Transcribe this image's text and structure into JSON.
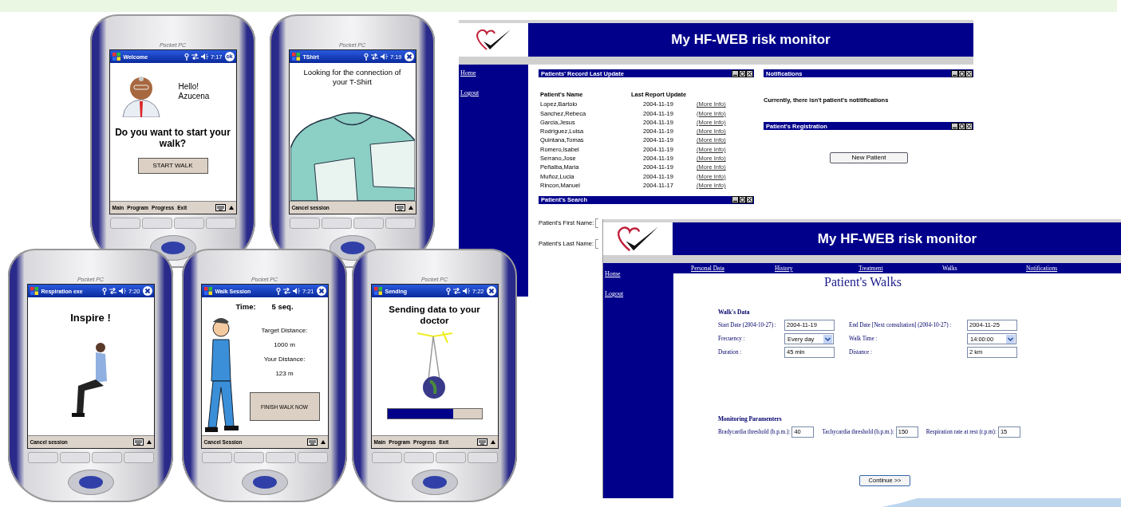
{
  "phones": [
    {
      "kind": "welcome",
      "brand": "Pocket PC",
      "title": "Welcome",
      "time": "7:17",
      "title_button": {
        "kind": "ok",
        "label": "ok"
      },
      "greeting": "Hello!",
      "name": "Azucena",
      "question": "Do you want to start your walk?",
      "button": "START WALK",
      "menu": [
        "Main",
        "Program",
        "Progress",
        "Exit"
      ]
    },
    {
      "kind": "tshirt",
      "brand": "Pocket PC",
      "title": "TShirt",
      "time": "7:19",
      "title_button": {
        "kind": "close"
      },
      "message": "Looking for the connection of your T-Shirt",
      "menu": [
        "Cancel session"
      ]
    },
    {
      "kind": "respiration",
      "brand": "Pocket PC",
      "title": "Respiration exe",
      "time": "7:20",
      "title_button": {
        "kind": "close"
      },
      "instruction": "Inspire !",
      "menu": [
        "Cancel session"
      ]
    },
    {
      "kind": "walk",
      "brand": "Pocket PC",
      "title": "Walk Session",
      "time": "7:21",
      "title_button": {
        "kind": "close"
      },
      "time_label": "Time:",
      "time_value": "5 seq.",
      "target_label": "Target Distance:",
      "target_value": "1000 m",
      "distance_label": "Your Distance:",
      "distance_value": "123 m",
      "button": "FINISH WALK NOW",
      "menu": [
        "Cancel Session"
      ]
    },
    {
      "kind": "sending",
      "brand": "Pocket PC",
      "title": "Sending",
      "time": "7:22",
      "title_button": {
        "kind": "close"
      },
      "message": "Sending data to your doctor",
      "progress": {
        "level": 0.7
      },
      "menu": [
        "Main",
        "Program",
        "Progress",
        "Exit"
      ]
    }
  ],
  "dashboard": {
    "title": "My HF-WEB risk monitor",
    "sidebar": [
      "Home",
      "Logout"
    ],
    "records": {
      "title": "Patients' Record Last Update",
      "columns": [
        "Patient's Name",
        "Last Report Update"
      ],
      "rows": [
        {
          "name": "Lopez,Bartolo",
          "date": "2004-11-19",
          "link": "(More Info)"
        },
        {
          "name": "Sanchez,Rebeca",
          "date": "2004-11-19",
          "link": "(More Info)"
        },
        {
          "name": "Garcia,Jesus",
          "date": "2004-11-19",
          "link": "(More Info)"
        },
        {
          "name": "Rodriguez,Luisa",
          "date": "2004-11-19",
          "link": "(More Info)"
        },
        {
          "name": "Quintana,Tomas",
          "date": "2004-11-19",
          "link": "(More Info)"
        },
        {
          "name": "Romero,Isabel",
          "date": "2004-11-19",
          "link": "(More Info)"
        },
        {
          "name": "Serrano,Jose",
          "date": "2004-11-19",
          "link": "(More Info)"
        },
        {
          "name": "Peñalba,Maria",
          "date": "2004-11-19",
          "link": "(More Info)"
        },
        {
          "name": "Muñoz,Lucia",
          "date": "2004-11-19",
          "link": "(More Info)"
        },
        {
          "name": "Rincon,Manuel",
          "date": "2004-11-17",
          "link": "(More Info)"
        }
      ]
    },
    "search": {
      "title": "Patient's Search",
      "fields": [
        "Patient's First Name:",
        "Patient's Last Name:"
      ]
    },
    "notifications": {
      "title": "Notifications",
      "message": "Currently, there isn't patient's notitifications"
    },
    "registration": {
      "title": "Patient's Registration",
      "button": "New Patient"
    }
  },
  "walks_page": {
    "title": "My HF-WEB risk monitor",
    "sidebar": [
      "Home",
      "Logout"
    ],
    "tabs": [
      {
        "label": "Personal Data",
        "selected": false
      },
      {
        "label": "History",
        "selected": false
      },
      {
        "label": "Treatment",
        "selected": false
      },
      {
        "label": "Walks",
        "selected": true
      },
      {
        "label": "Notifications",
        "selected": false
      }
    ],
    "heading": "Patient's Walks",
    "walk_section": "Walk's Data",
    "walk_fields": [
      {
        "label": "Start Date (2004-10-27) :",
        "value": "2004-11-19",
        "kind": "text"
      },
      {
        "label": "End Date [Next consultation] (2004-10-27) :",
        "value": "2004-11-25",
        "kind": "text"
      },
      {
        "label": "Frecuency :",
        "value": "Every day",
        "kind": "select"
      },
      {
        "label": "Walk Time :",
        "value": "14:00:00",
        "kind": "select"
      },
      {
        "label": "Duration :",
        "value": "45 min",
        "kind": "text"
      },
      {
        "label": "Distance :",
        "value": "2 km",
        "kind": "text"
      }
    ],
    "monitoring_section": "Monitoring Paramenters",
    "monitoring_fields": [
      {
        "label": "Bradycardia threshold (b.p.m.):",
        "value": "40"
      },
      {
        "label": "Tachycardia threshold (b.p.m.):",
        "value": "150"
      },
      {
        "label": "Respiration rate at rest (r.p.m):",
        "value": "15"
      }
    ],
    "button": "Continue >>"
  }
}
